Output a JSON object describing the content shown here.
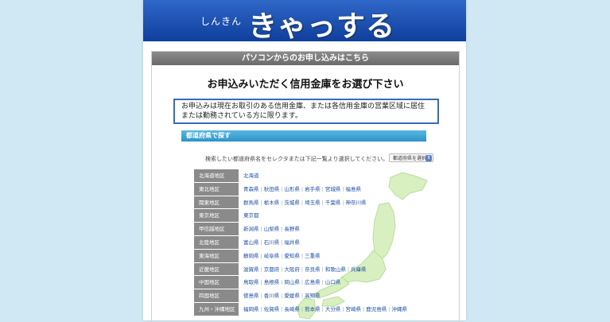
{
  "header": {
    "brand_small": "しんきん",
    "brand_large": "きゃっする"
  },
  "page": {
    "section_title": "パソコンからのお申し込みはこちら",
    "main_title": "お申込みいただく信用金庫をお選び下さい",
    "notice": "お申込みは現在お取引のある信用金庫、または各信用金庫の営業区域に居住または勤務されている方に限ります。",
    "search_heading": "都道府県で探す",
    "instruction": "検索したい都道府県名をセレクタまたは下記一覧より選択してください。",
    "select_label": "都道府県を選択"
  },
  "regions": [
    {
      "name": "北海道地区",
      "prefs": [
        "北海道"
      ]
    },
    {
      "name": "東北地区",
      "prefs": [
        "青森県",
        "秋田県",
        "山形県",
        "岩手県",
        "宮城県",
        "福島県"
      ]
    },
    {
      "name": "関東地区",
      "prefs": [
        "群馬県",
        "栃木県",
        "茨城県",
        "埼玉県",
        "千葉県",
        "神奈川県"
      ]
    },
    {
      "name": "東京地区",
      "prefs": [
        "東京都"
      ]
    },
    {
      "name": "甲信越地区",
      "prefs": [
        "新潟県",
        "山梨県",
        "長野県"
      ]
    },
    {
      "name": "北陸地区",
      "prefs": [
        "富山県",
        "石川県",
        "福井県"
      ]
    },
    {
      "name": "東海地区",
      "prefs": [
        "静岡県",
        "岐阜県",
        "愛知県",
        "三重県"
      ]
    },
    {
      "name": "近畿地区",
      "prefs": [
        "滋賀県",
        "京都府",
        "大阪府",
        "奈良県",
        "和歌山県",
        "兵庫県"
      ]
    },
    {
      "name": "中国地区",
      "prefs": [
        "鳥取県",
        "島根県",
        "岡山県",
        "広島県",
        "山口県"
      ]
    },
    {
      "name": "四国地区",
      "prefs": [
        "徳島県",
        "香川県",
        "愛媛県",
        "高知県"
      ]
    },
    {
      "name": "九州・沖縄地区",
      "prefs": [
        "福岡県",
        "佐賀県",
        "長崎県",
        "熊本県",
        "大分県",
        "宮崎県",
        "鹿児島県",
        "沖縄県"
      ]
    }
  ],
  "colors": {
    "header_blue": "#1a4fb0",
    "link_blue": "#1e4fa5",
    "map_green": "#d8f0c0",
    "region_grey": "#8a8a8a"
  }
}
